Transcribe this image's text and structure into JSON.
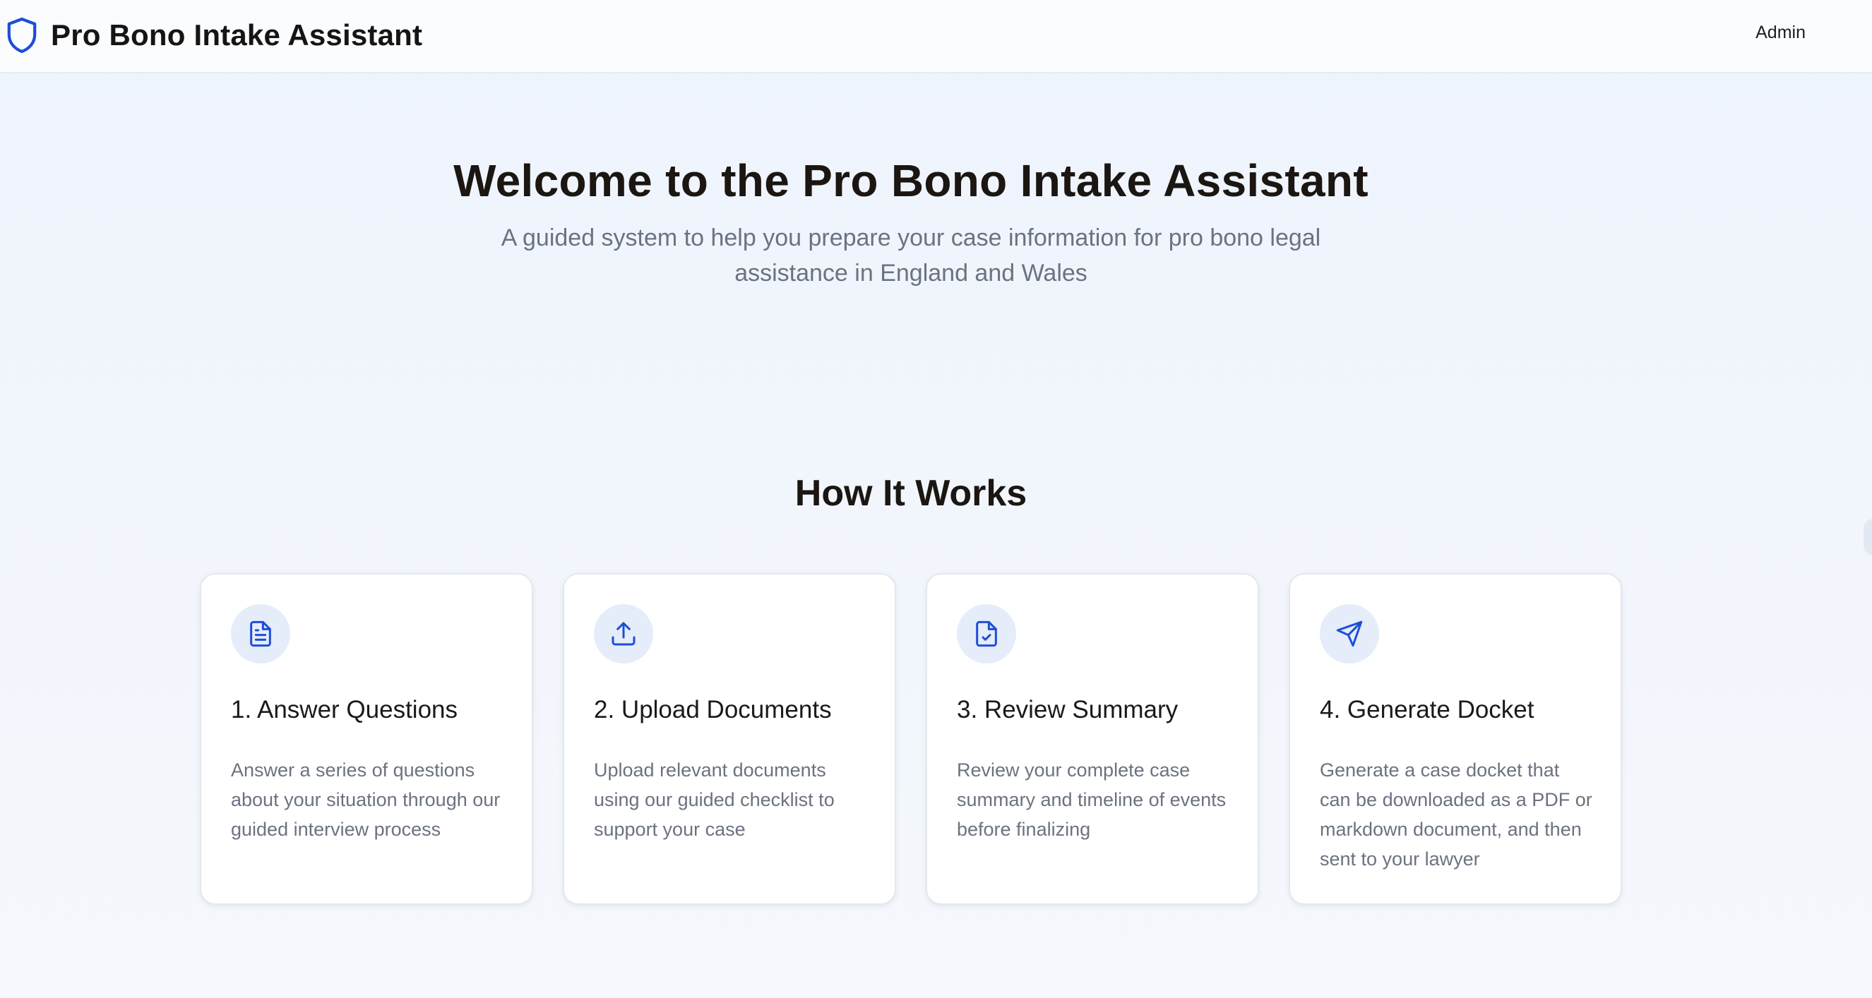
{
  "header": {
    "app_title": "Pro Bono Intake Assistant",
    "admin_label": "Admin",
    "logo_icon": "shield-icon"
  },
  "hero": {
    "title": "Welcome to the Pro Bono Intake Assistant",
    "subtitle": "A guided system to help you prepare your case information for pro bono legal assistance in England and Wales"
  },
  "how_it_works": {
    "heading": "How It Works",
    "steps": [
      {
        "icon": "document-icon",
        "title": "1. Answer Questions",
        "description": "Answer a series of questions about your situation through our guided interview process"
      },
      {
        "icon": "upload-icon",
        "title": "2. Upload Documents",
        "description": "Upload relevant documents using our guided checklist to support your case"
      },
      {
        "icon": "file-check-icon",
        "title": "3. Review Summary",
        "description": "Review your complete case summary and timeline of events before finalizing"
      },
      {
        "icon": "send-icon",
        "title": "4. Generate Docket",
        "description": "Generate a case docket that can be downloaded as a PDF or markdown document, and then sent to your lawyer"
      }
    ]
  },
  "colors": {
    "accent": "#1d4ed8",
    "icon_bg": "#e5ecfa",
    "page_bg": "#eef4fd",
    "muted_text": "#6b7280"
  }
}
